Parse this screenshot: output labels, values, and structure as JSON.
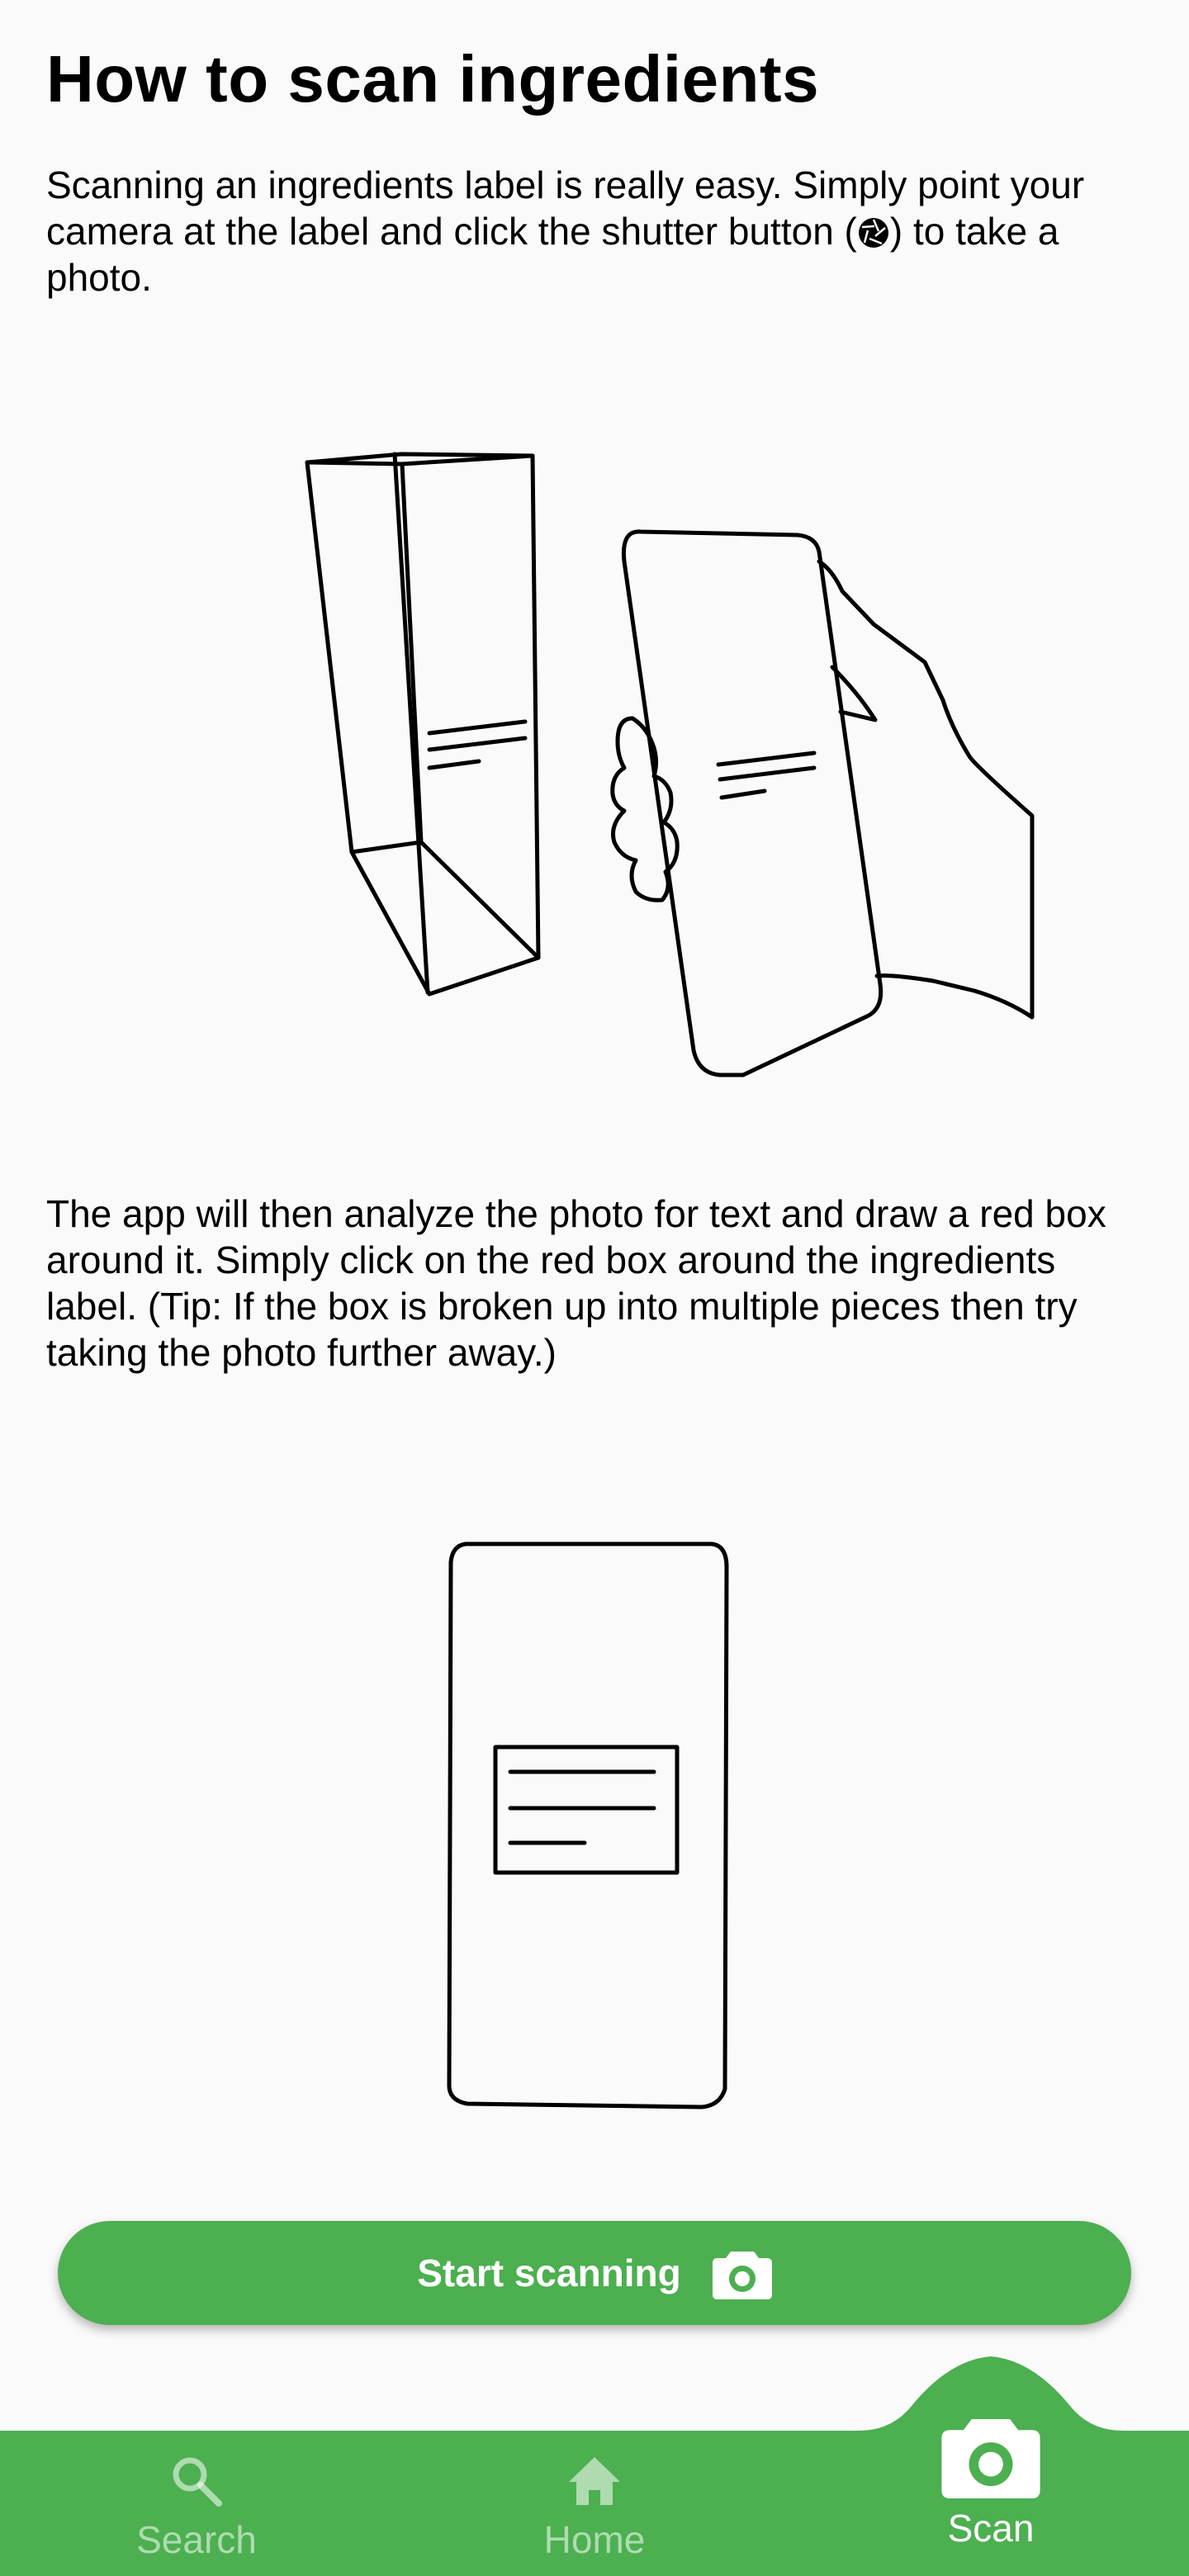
{
  "page": {
    "title": "How to scan ingredients",
    "paragraph1_before_icon": "Scanning an ingredients label is really easy. Simply point your camera at the label and click the shutter button (",
    "paragraph1_after_icon": ") to take a photo.",
    "paragraph2": "The app will then analyze the photo for text and draw a red box around it. Simply click on the red box around the ingredients label. (Tip: If the box is broken up into multiple pieces then try taking the photo further away.)",
    "start_button_label": "Start scanning"
  },
  "bottom_nav": {
    "items": [
      {
        "label": "Search",
        "icon": "search-icon",
        "active": false
      },
      {
        "label": "Home",
        "icon": "home-icon",
        "active": false
      },
      {
        "label": "Scan",
        "icon": "camera-icon",
        "active": true
      }
    ]
  },
  "colors": {
    "accent": "#4caf50",
    "background": "#fafafa",
    "inactive_nav_label": "rgba(255,255,255,0.55)"
  }
}
